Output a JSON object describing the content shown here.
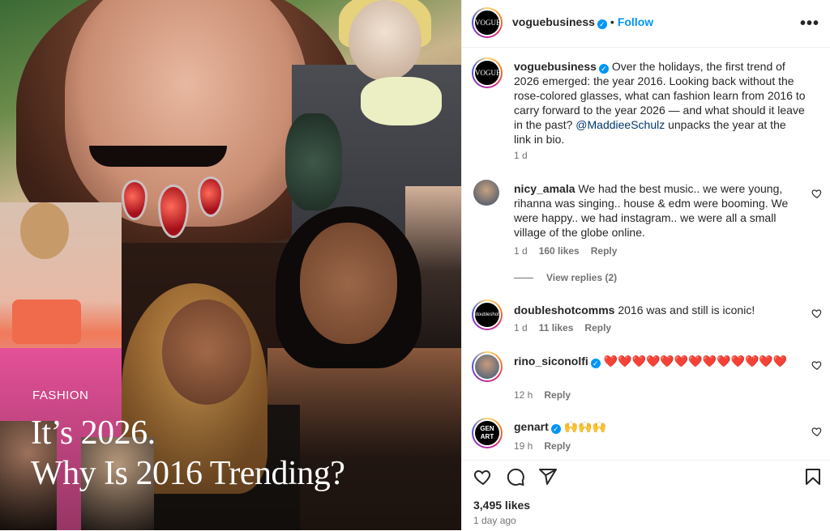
{
  "post_image": {
    "kicker": "FASHION",
    "headline_line1": "It’s 2026.",
    "headline_line2": "Why Is 2016 Trending?"
  },
  "header": {
    "avatar_text": "VOGUE",
    "username": "voguebusiness",
    "separator": "•",
    "follow_label": "Follow",
    "more_label": "•••"
  },
  "caption": {
    "avatar_text": "VOGUE",
    "username": "voguebusiness",
    "text_before_mention": "Over the holidays, the first trend of 2026 emerged: the year 2016. Looking back without the rose-colored glasses, what can fashion learn from 2016 to carry forward to the year 2026 — and what should it leave in the past?",
    "mention": "@MaddieeSchulz",
    "text_after_mention": "unpacks the year at the link in bio.",
    "time": "1 d"
  },
  "comments": [
    {
      "username": "nicy_amala",
      "verified": false,
      "text": "We had the best music.. we were young, rihanna was singing.. house & edm were booming. We were happy.. we had instagram.. we were all a small village of the globe online.",
      "time": "1 d",
      "likes": "160 likes",
      "reply_label": "Reply",
      "view_replies": "View replies (2)"
    },
    {
      "username": "doubleshotcomms",
      "verified": false,
      "avatar_text": "doubleshot",
      "text": "2016 was and still is iconic!",
      "time": "1 d",
      "likes": "11 likes",
      "reply_label": "Reply"
    },
    {
      "username": "rino_siconolfi",
      "verified": true,
      "text": "❤️❤️❤️❤️❤️❤️❤️❤️❤️❤️❤️❤️❤️",
      "time": "12 h",
      "reply_label": "Reply"
    },
    {
      "username": "genart",
      "verified": true,
      "avatar_text": "GEN ART",
      "text": "🙌🙌🙌",
      "time": "19 h",
      "reply_label": "Reply"
    }
  ],
  "footer": {
    "likes": "3,495 likes",
    "time_ago": "1 day ago"
  },
  "icons": [
    "heart-icon",
    "comment-icon",
    "share-icon",
    "bookmark-icon",
    "verified-badge-icon",
    "more-icon"
  ],
  "colors": {
    "accent": "#0095f6",
    "text": "#262626",
    "muted": "#737373",
    "mention": "#00376b"
  }
}
